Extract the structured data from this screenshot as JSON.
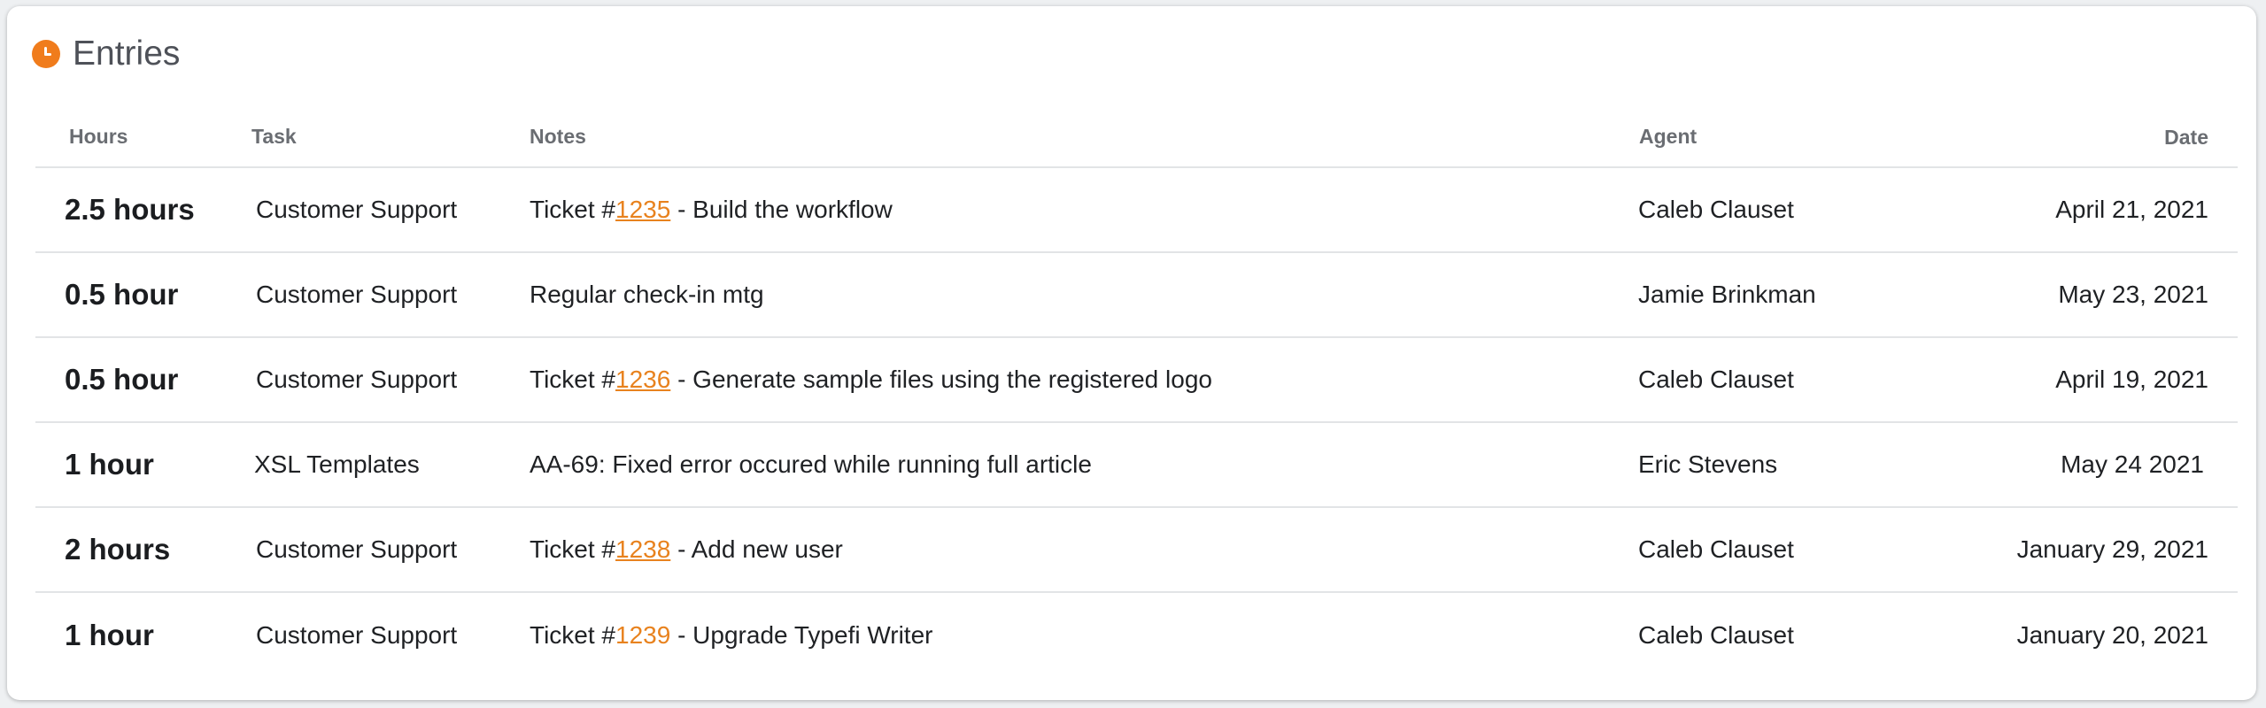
{
  "header": {
    "title": "Entries"
  },
  "columns": {
    "hours": "Hours",
    "task": "Task",
    "notes": "Notes",
    "agent": "Agent",
    "date": "Date"
  },
  "accent_color": "#f07c1c",
  "rows": [
    {
      "hours": "2.5 hours",
      "task": "Customer Support",
      "note_prefix": "Ticket #",
      "ticket": "1235",
      "note_suffix": " - Build the workflow",
      "agent": "Caleb Clauset",
      "date": "April 21, 2021"
    },
    {
      "hours": "0.5 hour",
      "task": "Customer Support",
      "note_prefix": "Regular check-in mtg",
      "ticket": "",
      "note_suffix": "",
      "agent": "Jamie Brinkman",
      "date": "May 23, 2021"
    },
    {
      "hours": "0.5 hour",
      "task": "Customer Support",
      "note_prefix": "Ticket #",
      "ticket": "1236",
      "note_suffix": " - Generate sample files using the registered logo",
      "agent": "Caleb Clauset",
      "date": "April 19, 2021"
    },
    {
      "hours": "1 hour",
      "task": "XSL Templates",
      "note_prefix": "AA-69: Fixed error occured while running full article",
      "ticket": "",
      "note_suffix": "",
      "agent": "Eric Stevens",
      "date": "May 24 2021"
    },
    {
      "hours": "2 hours",
      "task": "Customer Support",
      "note_prefix": "Ticket #",
      "ticket": "1238",
      "note_suffix": " - Add new user",
      "agent": "Caleb Clauset",
      "date": "January 29, 2021"
    },
    {
      "hours": "1 hour",
      "task": "Customer Support",
      "note_prefix": "Ticket #",
      "ticket": "1239",
      "note_suffix": " - Upgrade Typefi Writer",
      "agent": "Caleb Clauset",
      "date": "January 20, 2021"
    }
  ]
}
